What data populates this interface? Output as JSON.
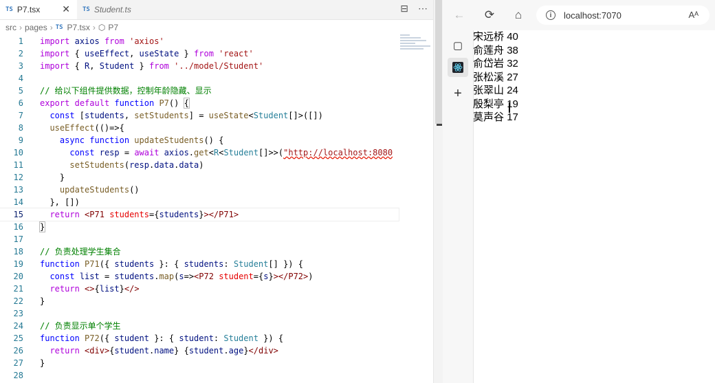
{
  "editor": {
    "tabs": [
      {
        "badge": "TS",
        "label": "P7.tsx",
        "close": "✕"
      },
      {
        "badge": "TS",
        "label": "Student.ts"
      }
    ],
    "actions": [
      "⊟",
      "⋯"
    ],
    "breadcrumb": {
      "src": "src",
      "pages": "pages",
      "file_badge": "TS",
      "file": "P7.tsx",
      "symbol": "P7"
    },
    "current_line": 15
  },
  "browser": {
    "back": "←",
    "reload": "⟳",
    "home": "⌂",
    "url": "localhost:7070",
    "read_aloud": "Aᴬ",
    "rail": {
      "tabs_icon": "▢",
      "add": "+"
    },
    "students": [
      {
        "name": "宋远桥",
        "age": "40"
      },
      {
        "name": "俞莲舟",
        "age": "38"
      },
      {
        "name": "俞岱岩",
        "age": "32"
      },
      {
        "name": "张松溪",
        "age": "27"
      },
      {
        "name": "张翠山",
        "age": "24"
      },
      {
        "name": "殷梨亭",
        "age": "19"
      },
      {
        "name": "莫声谷",
        "age": "17"
      }
    ]
  },
  "colors": {
    "keyword": "#0000ff",
    "control": "#af00db",
    "string": "#a31515",
    "comment": "#008000",
    "function": "#795e26",
    "type": "#267f99",
    "variable": "#001080"
  }
}
